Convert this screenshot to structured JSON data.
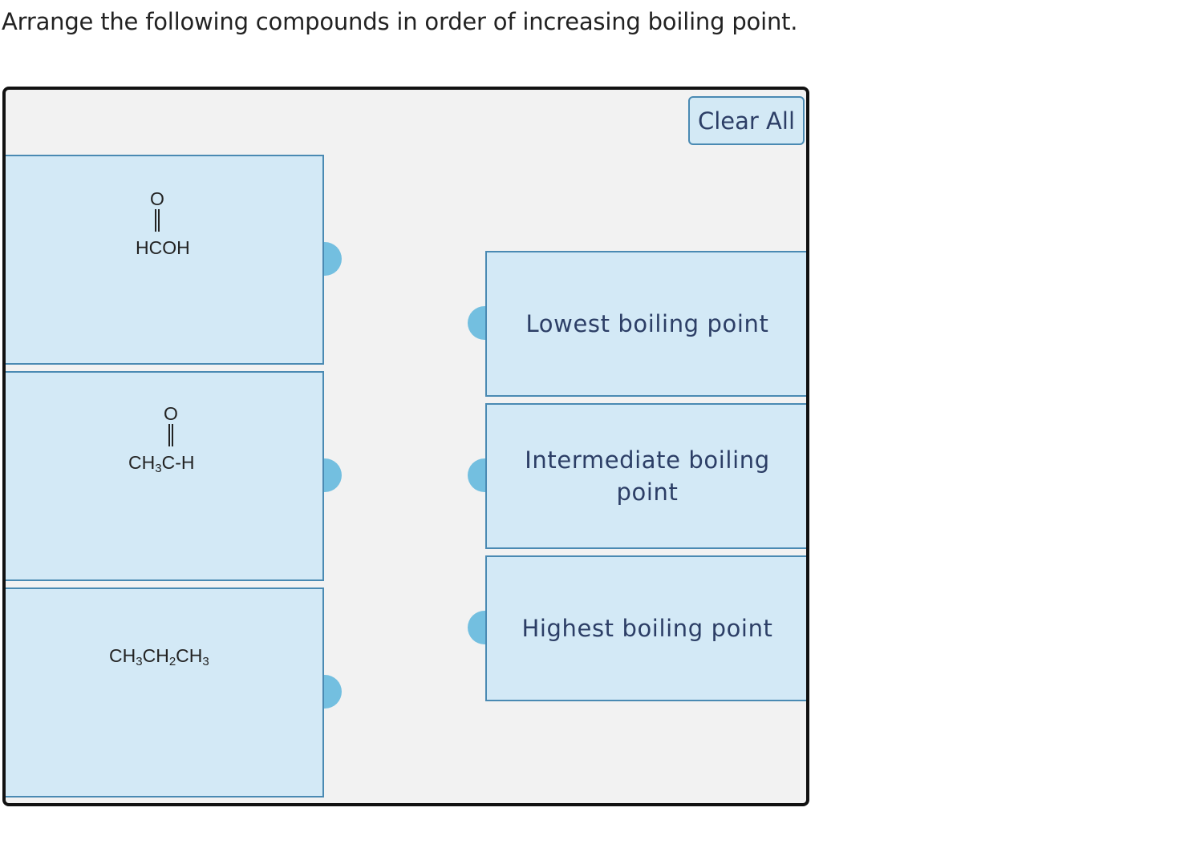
{
  "question": "Arrange the following compounds in order of increasing boiling point.",
  "clear_all_label": "Clear All",
  "compounds": [
    {
      "top_atom": "O",
      "formula_main": "HCOH"
    },
    {
      "top_atom": "O",
      "formula_part1": "CH",
      "sub1": "3",
      "formula_part2": "C-H"
    },
    {
      "f1": "CH",
      "s1": "3",
      "f2": "CH",
      "s2": "2",
      "f3": "CH",
      "s3": "3"
    }
  ],
  "targets": [
    {
      "label": "Lowest boiling point"
    },
    {
      "label": "Intermediate boiling point"
    },
    {
      "label": "Highest boiling point"
    }
  ],
  "colors": {
    "card_bg": "#d3e9f6",
    "card_border": "#4a8ab3",
    "handle": "#73bfe0",
    "workspace_bg": "#f2f2f2"
  }
}
